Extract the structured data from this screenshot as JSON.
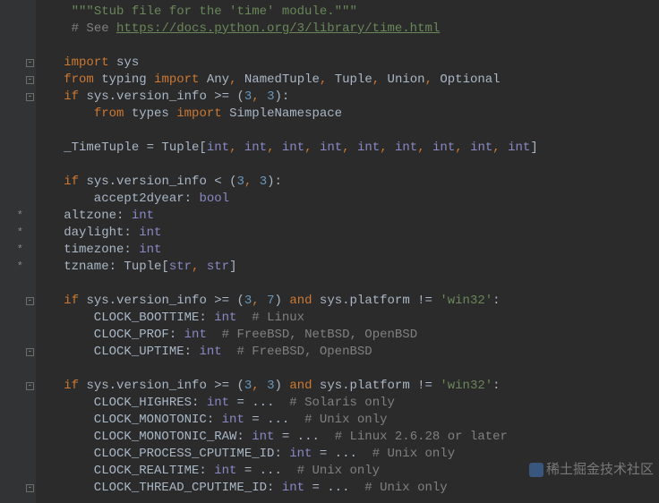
{
  "lines": [
    {
      "gutter": {},
      "tokens": [
        {
          "t": "    "
        },
        {
          "c": "str",
          "t": "\"\"\"Stub file for the 'time' module.\"\"\""
        }
      ]
    },
    {
      "gutter": {},
      "tokens": [
        {
          "t": "    "
        },
        {
          "c": "cmt",
          "t": "# See "
        },
        {
          "c": "link",
          "t": "https://docs.python.org/3/library/time.html"
        }
      ]
    },
    {
      "gutter": {},
      "tokens": [
        {
          "t": " "
        }
      ]
    },
    {
      "gutter": {
        "fold": "-"
      },
      "tokens": [
        {
          "t": "   "
        },
        {
          "c": "kw",
          "t": "import "
        },
        {
          "t": "sys"
        }
      ]
    },
    {
      "gutter": {
        "fold": "-"
      },
      "tokens": [
        {
          "t": "   "
        },
        {
          "c": "kw",
          "t": "from "
        },
        {
          "t": "typing "
        },
        {
          "c": "kw",
          "t": "import "
        },
        {
          "t": "Any"
        },
        {
          "c": "kw",
          "t": ", "
        },
        {
          "t": "NamedTuple"
        },
        {
          "c": "kw",
          "t": ", "
        },
        {
          "t": "Tuple"
        },
        {
          "c": "kw",
          "t": ", "
        },
        {
          "t": "Union"
        },
        {
          "c": "kw",
          "t": ", "
        },
        {
          "t": "Optional"
        }
      ]
    },
    {
      "gutter": {
        "fold": "-"
      },
      "tokens": [
        {
          "t": "   "
        },
        {
          "c": "kw",
          "t": "if "
        },
        {
          "t": "sys.version_info >= ("
        },
        {
          "c": "num",
          "t": "3"
        },
        {
          "c": "kw",
          "t": ", "
        },
        {
          "c": "num",
          "t": "3"
        },
        {
          "t": "):"
        }
      ]
    },
    {
      "gutter": {},
      "tokens": [
        {
          "t": "       "
        },
        {
          "c": "kw",
          "t": "from "
        },
        {
          "t": "types "
        },
        {
          "c": "kw",
          "t": "import "
        },
        {
          "t": "SimpleNamespace"
        }
      ]
    },
    {
      "gutter": {},
      "tokens": [
        {
          "t": " "
        }
      ]
    },
    {
      "gutter": {},
      "tokens": [
        {
          "t": "   _TimeTuple = Tuple["
        },
        {
          "c": "builtin",
          "t": "int"
        },
        {
          "c": "kw",
          "t": ", "
        },
        {
          "c": "builtin",
          "t": "int"
        },
        {
          "c": "kw",
          "t": ", "
        },
        {
          "c": "builtin",
          "t": "int"
        },
        {
          "c": "kw",
          "t": ", "
        },
        {
          "c": "builtin",
          "t": "int"
        },
        {
          "c": "kw",
          "t": ", "
        },
        {
          "c": "builtin",
          "t": "int"
        },
        {
          "c": "kw",
          "t": ", "
        },
        {
          "c": "builtin",
          "t": "int"
        },
        {
          "c": "kw",
          "t": ", "
        },
        {
          "c": "builtin",
          "t": "int"
        },
        {
          "c": "kw",
          "t": ", "
        },
        {
          "c": "builtin",
          "t": "int"
        },
        {
          "c": "kw",
          "t": ", "
        },
        {
          "c": "builtin",
          "t": "int"
        },
        {
          "t": "]"
        }
      ]
    },
    {
      "gutter": {},
      "tokens": [
        {
          "t": " "
        }
      ]
    },
    {
      "gutter": {},
      "tokens": [
        {
          "t": "   "
        },
        {
          "c": "kw",
          "t": "if "
        },
        {
          "t": "sys.version_info < ("
        },
        {
          "c": "num",
          "t": "3"
        },
        {
          "c": "kw",
          "t": ", "
        },
        {
          "c": "num",
          "t": "3"
        },
        {
          "t": "):"
        }
      ]
    },
    {
      "gutter": {},
      "tokens": [
        {
          "t": "       accept2dyear: "
        },
        {
          "c": "builtin",
          "t": "bool"
        }
      ]
    },
    {
      "gutter": {
        "star": "*"
      },
      "tokens": [
        {
          "t": "   altzone: "
        },
        {
          "c": "builtin",
          "t": "int"
        }
      ]
    },
    {
      "gutter": {
        "star": "*"
      },
      "tokens": [
        {
          "t": "   daylight: "
        },
        {
          "c": "builtin",
          "t": "int"
        }
      ]
    },
    {
      "gutter": {
        "star": "*"
      },
      "tokens": [
        {
          "t": "   timezone: "
        },
        {
          "c": "builtin",
          "t": "int"
        }
      ]
    },
    {
      "gutter": {
        "star": "*"
      },
      "tokens": [
        {
          "t": "   tzname: Tuple["
        },
        {
          "c": "builtin",
          "t": "str"
        },
        {
          "c": "kw",
          "t": ", "
        },
        {
          "c": "builtin",
          "t": "str"
        },
        {
          "t": "]"
        }
      ]
    },
    {
      "gutter": {},
      "tokens": [
        {
          "t": " "
        }
      ]
    },
    {
      "gutter": {
        "fold": "-"
      },
      "tokens": [
        {
          "t": "   "
        },
        {
          "c": "kw",
          "t": "if "
        },
        {
          "t": "sys.version_info >= ("
        },
        {
          "c": "num",
          "t": "3"
        },
        {
          "c": "kw",
          "t": ", "
        },
        {
          "c": "num",
          "t": "7"
        },
        {
          "t": ") "
        },
        {
          "c": "kw",
          "t": "and "
        },
        {
          "t": "sys.platform != "
        },
        {
          "c": "str",
          "t": "'win32'"
        },
        {
          "t": ":"
        }
      ]
    },
    {
      "gutter": {},
      "tokens": [
        {
          "t": "       CLOCK_BOOTTIME: "
        },
        {
          "c": "builtin",
          "t": "int"
        },
        {
          "t": "  "
        },
        {
          "c": "cmt",
          "t": "# Linux"
        }
      ]
    },
    {
      "gutter": {},
      "tokens": [
        {
          "t": "       CLOCK_PROF: "
        },
        {
          "c": "builtin",
          "t": "int"
        },
        {
          "t": "  "
        },
        {
          "c": "cmt",
          "t": "# FreeBSD, NetBSD, OpenBSD"
        }
      ]
    },
    {
      "gutter": {
        "fold": "-"
      },
      "tokens": [
        {
          "t": "       CLOCK_UPTIME: "
        },
        {
          "c": "builtin",
          "t": "int"
        },
        {
          "t": "  "
        },
        {
          "c": "cmt",
          "t": "# FreeBSD, OpenBSD"
        }
      ]
    },
    {
      "gutter": {},
      "tokens": [
        {
          "t": " "
        }
      ]
    },
    {
      "gutter": {
        "fold": "-"
      },
      "tokens": [
        {
          "t": "   "
        },
        {
          "c": "kw",
          "t": "if "
        },
        {
          "t": "sys.version_info >= ("
        },
        {
          "c": "num",
          "t": "3"
        },
        {
          "c": "kw",
          "t": ", "
        },
        {
          "c": "num",
          "t": "3"
        },
        {
          "t": ") "
        },
        {
          "c": "kw",
          "t": "and "
        },
        {
          "t": "sys.platform != "
        },
        {
          "c": "str",
          "t": "'win32'"
        },
        {
          "t": ":"
        }
      ]
    },
    {
      "gutter": {},
      "tokens": [
        {
          "t": "       CLOCK_HIGHRES: "
        },
        {
          "c": "builtin",
          "t": "int"
        },
        {
          "t": " = ...  "
        },
        {
          "c": "cmt",
          "t": "# Solaris only"
        }
      ]
    },
    {
      "gutter": {},
      "tokens": [
        {
          "t": "       CLOCK_MONOTONIC: "
        },
        {
          "c": "builtin",
          "t": "int"
        },
        {
          "t": " = ...  "
        },
        {
          "c": "cmt",
          "t": "# Unix only"
        }
      ]
    },
    {
      "gutter": {},
      "tokens": [
        {
          "t": "       CLOCK_MONOTONIC_RAW: "
        },
        {
          "c": "builtin",
          "t": "int"
        },
        {
          "t": " = ...  "
        },
        {
          "c": "cmt",
          "t": "# Linux 2.6.28 or later"
        }
      ]
    },
    {
      "gutter": {},
      "tokens": [
        {
          "t": "       CLOCK_PROCESS_CPUTIME_ID: "
        },
        {
          "c": "builtin",
          "t": "int"
        },
        {
          "t": " = ...  "
        },
        {
          "c": "cmt",
          "t": "# Unix only"
        }
      ]
    },
    {
      "gutter": {},
      "tokens": [
        {
          "t": "       CLOCK_REALTIME: "
        },
        {
          "c": "builtin",
          "t": "int"
        },
        {
          "t": " = ...  "
        },
        {
          "c": "cmt",
          "t": "# Unix only"
        }
      ]
    },
    {
      "gutter": {
        "fold": "-"
      },
      "tokens": [
        {
          "t": "       CLOCK_THREAD_CPUTIME_ID: "
        },
        {
          "c": "builtin",
          "t": "int"
        },
        {
          "t": " = ...  "
        },
        {
          "c": "cmt",
          "t": "# Unix only"
        }
      ]
    }
  ],
  "watermark": "稀土掘金技术社区"
}
